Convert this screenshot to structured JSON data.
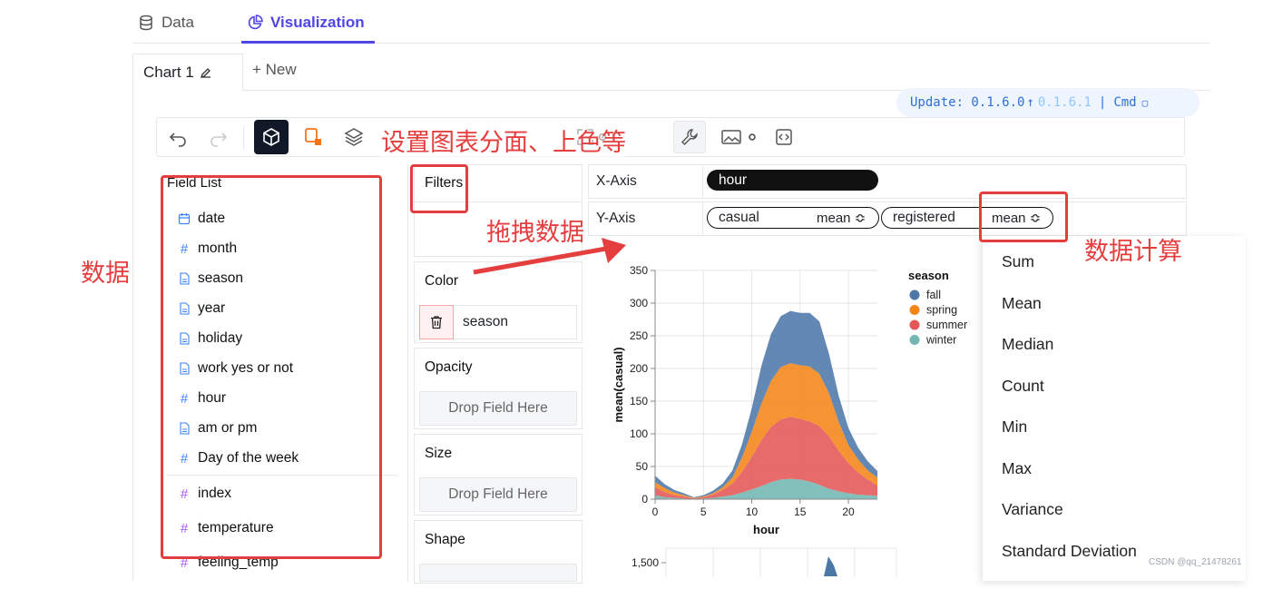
{
  "top_tabs": {
    "data": "Data",
    "visualization": "Visualization"
  },
  "chart_tabs": {
    "chart1": "Chart 1",
    "new": "+ New"
  },
  "update": {
    "label": "Update: 0.1.6.0",
    "arrow": "↑",
    "new_version": "0.1.6.1",
    "sep": "|",
    "cmd": "Cmd"
  },
  "field_list": {
    "title": "Field List",
    "fields": [
      {
        "name": "date",
        "icon": "calendar-icon"
      },
      {
        "name": "month",
        "icon": "hash-icon"
      },
      {
        "name": "season",
        "icon": "doc-icon"
      },
      {
        "name": "year",
        "icon": "doc-icon"
      },
      {
        "name": "holiday",
        "icon": "doc-icon"
      },
      {
        "name": "work yes or not",
        "icon": "doc-icon"
      },
      {
        "name": "hour",
        "icon": "hash-icon"
      },
      {
        "name": "am or pm",
        "icon": "doc-icon"
      },
      {
        "name": "Day of the week",
        "icon": "hash-icon"
      }
    ],
    "measures": [
      {
        "name": "index",
        "icon": "hash-icon"
      },
      {
        "name": "temperature",
        "icon": "hash-icon"
      },
      {
        "name": "feeling_temp",
        "icon": "hash-icon"
      }
    ]
  },
  "encodings": {
    "filters": "Filters",
    "color": "Color",
    "color_field": "season",
    "opacity": "Opacity",
    "size": "Size",
    "shape": "Shape",
    "drop_placeholder": "Drop Field Here"
  },
  "axes": {
    "x_label": "X-Axis",
    "x_field": "hour",
    "y_label": "Y-Axis",
    "y_fields": [
      {
        "name": "casual",
        "agg": "mean ≎"
      },
      {
        "name": "registered",
        "agg": "mean ≎"
      }
    ]
  },
  "agg_menu": [
    "Sum",
    "Mean",
    "Median",
    "Count",
    "Min",
    "Max",
    "Variance",
    "Standard Deviation"
  ],
  "annotations": {
    "toolbar_note": "设置图表分面、上色等",
    "drag_note": "拖拽数据",
    "data_note": "数据",
    "calc_note": "数据计算"
  },
  "watermark": "CSDN @qq_21478261",
  "colors": {
    "accent": "#4f46e5",
    "annotation": "#e53e3e",
    "fall": "#4c78a8",
    "spring": "#f58518",
    "summer": "#e45756",
    "winter": "#72b7b2"
  },
  "chart_data": {
    "type": "area",
    "stacked": true,
    "title": "",
    "xlabel": "hour",
    "ylabel": "mean(casual)",
    "xlim": [
      0,
      23
    ],
    "ylim": [
      0,
      350
    ],
    "x_ticks": [
      0,
      5,
      10,
      15,
      20
    ],
    "y_ticks": [
      0,
      50,
      100,
      150,
      200,
      250,
      300,
      350
    ],
    "legend_title": "season",
    "legend_position": "top-right",
    "grid": true,
    "x": [
      0,
      1,
      2,
      3,
      4,
      5,
      6,
      7,
      8,
      9,
      10,
      11,
      12,
      13,
      14,
      15,
      16,
      17,
      18,
      19,
      20,
      21,
      22,
      23
    ],
    "series": [
      {
        "name": "fall",
        "values": [
          10,
          6,
          4,
          3,
          1,
          2,
          4,
          6,
          11,
          20,
          36,
          58,
          72,
          78,
          80,
          80,
          82,
          80,
          60,
          40,
          26,
          18,
          14,
          10
        ]
      },
      {
        "name": "spring",
        "values": [
          8,
          6,
          4,
          2,
          1,
          1,
          2,
          4,
          9,
          22,
          38,
          56,
          70,
          80,
          82,
          82,
          84,
          80,
          66,
          44,
          28,
          20,
          14,
          12
        ]
      },
      {
        "name": "summer",
        "values": [
          12,
          8,
          4,
          3,
          1,
          2,
          5,
          10,
          18,
          32,
          50,
          70,
          85,
          92,
          95,
          93,
          92,
          90,
          80,
          62,
          46,
          34,
          24,
          16
        ]
      },
      {
        "name": "winter",
        "values": [
          6,
          3,
          2,
          1,
          0,
          1,
          2,
          4,
          6,
          10,
          15,
          20,
          26,
          30,
          31,
          30,
          27,
          22,
          16,
          12,
          9,
          7,
          6,
          5
        ]
      }
    ],
    "second_chart_first_tick": "1,500"
  }
}
